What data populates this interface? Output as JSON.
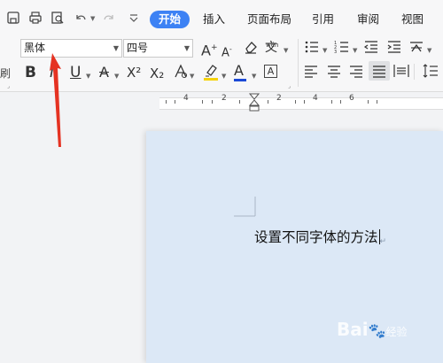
{
  "menu": {
    "tabs": [
      {
        "label": "开始",
        "active": true
      },
      {
        "label": "插入"
      },
      {
        "label": "页面布局"
      },
      {
        "label": "引用"
      },
      {
        "label": "审阅"
      },
      {
        "label": "视图"
      }
    ]
  },
  "quick_access": [
    "save-icon",
    "print-icon",
    "print-preview-icon",
    "undo-icon",
    "redo-icon",
    "customize-icon"
  ],
  "ribbon": {
    "font_name": "黑体",
    "font_size": "四号",
    "bold": "B",
    "italic": "I",
    "underline": "U",
    "strikethrough": "A",
    "superscript": "X²",
    "subscript": "X₂",
    "font_color": "A",
    "char_border": "A",
    "grow_font": "A⁺",
    "shrink_font": "A⁻",
    "phonetic": "wén",
    "left_cut_label": "刷"
  },
  "ruler": {
    "numbers": [
      "4",
      "2",
      "2",
      "4",
      "6"
    ]
  },
  "document": {
    "text": "设置不同字体的方法"
  },
  "watermark": {
    "brand": "Bai",
    "suffix": "经验"
  },
  "colors": {
    "accent": "#3d82f4",
    "font_color_bar": "#1b49d6",
    "highlight_bar": "#f5d20a",
    "page": "#dce8f6",
    "arrow": "#e53222"
  }
}
